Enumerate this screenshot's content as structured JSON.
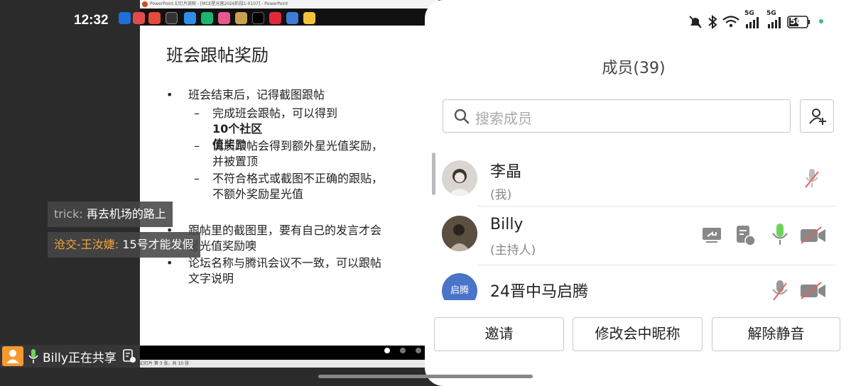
{
  "status": {
    "time": "12:32",
    "battery": "50",
    "network_5g_1": "5G",
    "network_5g_2": "5G"
  },
  "share": {
    "window_title": "PowerPoint 幻灯片放映 - [MCE星光营2026阶段1-0107] - PowerPoint",
    "status_text": "幻灯片 第 3 张，共 10 张",
    "slide_title": "班会跟帖奖励",
    "bullets": {
      "b1": "班会结束后，记得截图跟帖",
      "b1_s1_pre": "完成班会跟帖，可以得到",
      "b1_s1_bold1": "10个社区",
      "b1_s1_bold2": "值",
      "b1_s1_post": "奖励",
      "b1_s2_l1": "优质跟帖会得到额外星光值奖励，",
      "b1_s2_l2": "并被置顶",
      "b1_s3_l1": "不符合格式或截图不正确的跟贴，",
      "b1_s3_l2": "不额外奖励星光值",
      "b2_l1": "跟帖里的截图里，要有自己的发言才会",
      "b2_l2": "星光值奖励噢",
      "b3_l1": "论坛名称与腾讯会议不一致，可以跟帖",
      "b3_l2": "文字说明"
    },
    "page_dots": 3,
    "active_dot": 0
  },
  "chat": [
    {
      "name": "trick:",
      "text": " 再去机场的路上"
    },
    {
      "name": "沧交-王汝婕:",
      "text": " 15号才能发假"
    }
  ],
  "sharebar": {
    "text": "Billy正在共享"
  },
  "panel": {
    "title": "成员(39)",
    "search_placeholder": "搜索成员",
    "members": [
      {
        "name": "李晶",
        "role": "(我)"
      },
      {
        "name": "Billy",
        "role": "(主持人)"
      },
      {
        "name": "24晋中马启腾",
        "role": "",
        "avatar_text": "启腾"
      }
    ],
    "buttons": {
      "invite": "邀请",
      "rename": "修改会中昵称",
      "unmute": "解除静音"
    }
  },
  "colors": {
    "accent_orange": "#f2a53a",
    "mic_green": "#6ed35c",
    "muted_red": "#e0665a",
    "avatar_blue": "#4a74c9"
  }
}
